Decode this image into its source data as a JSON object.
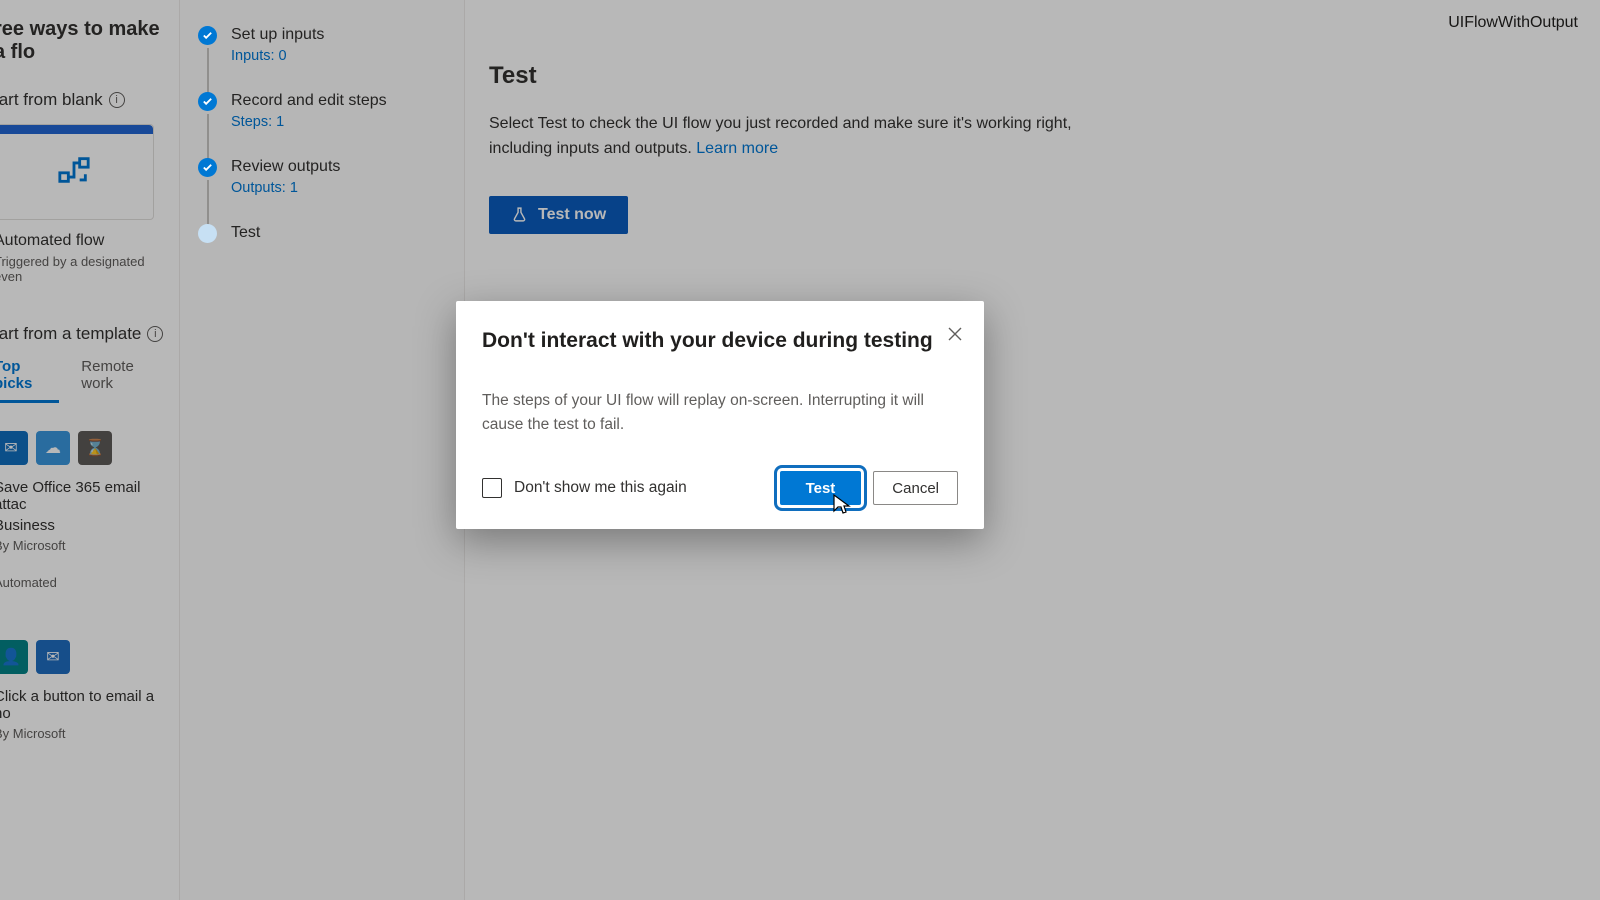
{
  "header": {
    "flow_name": "UIFlowWithOutput"
  },
  "left": {
    "heading": "ree ways to make a flo",
    "start_blank": "tart from blank",
    "flow_card_title": "Automated flow",
    "flow_card_sub": "Triggered by a designated even",
    "start_template": "tart from a template",
    "tabs": {
      "top": "Top picks",
      "remote": "Remote work"
    },
    "tmpl1_title": "Save Office 365 email attac",
    "tmpl1_title2": "Business",
    "tmpl_by": "By Microsoft",
    "tmpl_auto": "Automated",
    "tmpl2_title": "Click a button to email a no"
  },
  "steps": [
    {
      "label": "Set up inputs",
      "link": "Inputs: 0",
      "done": true
    },
    {
      "label": "Record and edit steps",
      "link": "Steps: 1",
      "done": true
    },
    {
      "label": "Review outputs",
      "link": "Outputs: 1",
      "done": true
    },
    {
      "label": "Test",
      "link": "",
      "done": false
    }
  ],
  "main": {
    "title": "Test",
    "desc_pre": "Select Test to check the UI flow you just recorded and make sure it's working right, including inputs and outputs. ",
    "desc_link": "Learn more",
    "button": "Test now"
  },
  "modal": {
    "title": "Don't interact with your device during testing",
    "body": "The steps of your UI flow will replay on-screen. Interrupting it will cause the test to fail.",
    "dont_show": "Don't show me this again",
    "test": "Test",
    "cancel": "Cancel"
  }
}
